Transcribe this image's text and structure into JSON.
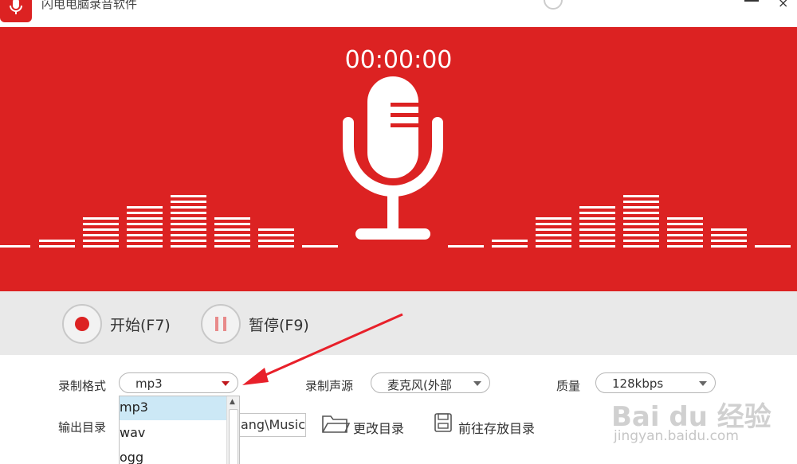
{
  "window": {
    "title": "闪电电脑录音软件",
    "close_glyph": "×"
  },
  "recorder": {
    "timer": "00:00:00"
  },
  "controls": {
    "start_label": "开始(F7)",
    "pause_label": "暂停(F9)"
  },
  "settings": {
    "format_label": "录制格式",
    "format_value": "mp3",
    "source_label": "录制声源",
    "source_value": "麦克风(外部",
    "quality_label": "质量",
    "quality_value": "128kbps",
    "output_label": "输出目录",
    "output_path": "ang\\Music",
    "change_dir_label": "更改目录",
    "open_dir_label": "前往存放目录"
  },
  "format_dropdown": {
    "options": [
      "mp3",
      "wav",
      "ogg"
    ],
    "selected": "mp3"
  },
  "watermark": {
    "brand": "Bai du 经验",
    "url": "jingyan.baidu.com"
  },
  "colors": {
    "accent_red": "#dc2222",
    "selection_blue": "#cce8f6",
    "arrow_red": "#e8202a"
  }
}
